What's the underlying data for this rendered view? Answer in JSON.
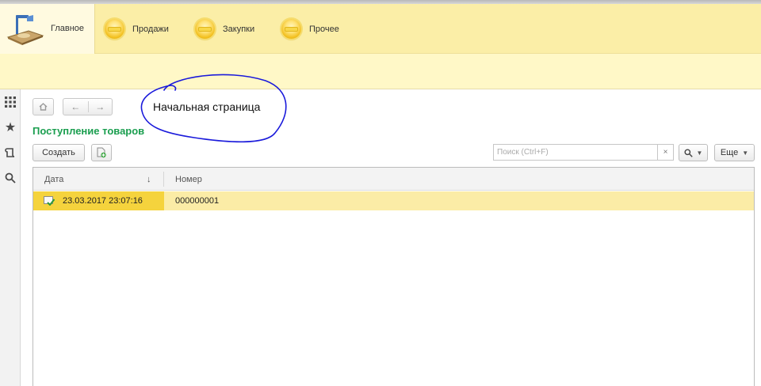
{
  "sections": {
    "items": [
      {
        "label": "Главное",
        "icon": "home-desk-icon",
        "active": true
      },
      {
        "label": "Продажи",
        "icon": "section-coin-icon"
      },
      {
        "label": "Закупки",
        "icon": "section-coin-icon"
      },
      {
        "label": "Прочее",
        "icon": "section-coin-icon"
      }
    ]
  },
  "tools": [
    "apps-grid-icon",
    "star-icon",
    "history-icon",
    "search-icon"
  ],
  "navigation": {
    "home_icon": "home-icon",
    "back_icon": "arrow-left-icon",
    "forward_icon": "arrow-right-icon"
  },
  "annotation": {
    "text": "Начальная страница",
    "color": "#1a1adb"
  },
  "form": {
    "title": "Поступление товаров",
    "title_color": "#1a9e4f",
    "create_label": "Создать",
    "copy_icon": "create-copy-icon",
    "search_placeholder": "Поиск (Ctrl+F)",
    "search_value": "",
    "clear_label": "×",
    "search_button_icon": "search-icon",
    "more_label": "Еще"
  },
  "table": {
    "columns": [
      "Дата",
      "Номер"
    ],
    "sort_indicator": "↓",
    "rows": [
      {
        "date": "23.03.2017 23:07:16",
        "number": "000000001",
        "icon": "posted-document-icon",
        "selected": true
      }
    ]
  },
  "colors": {
    "sections_bg": "#fbeea7",
    "open_band_bg": "#fff8c7",
    "selected_row": "#fbeca6",
    "selected_cell": "#f5d33d"
  }
}
